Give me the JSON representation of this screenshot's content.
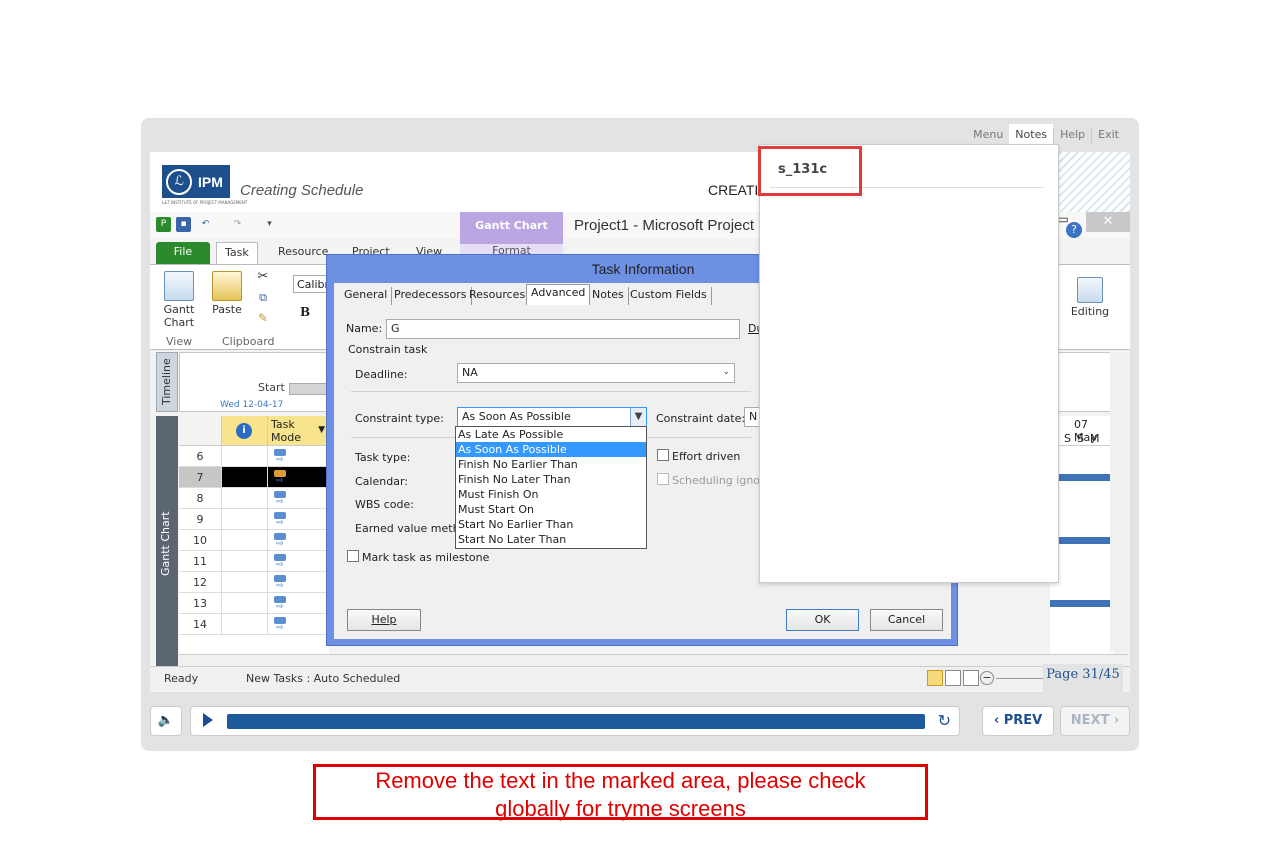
{
  "player": {
    "topnav": [
      "Menu",
      "Notes",
      "Help",
      "Exit"
    ],
    "active_nav": "Notes",
    "course_title": "Creating Schedule",
    "header_right": "CREATI",
    "page_counter": "Page 31/45",
    "prev_label": "PREV",
    "next_label": "NEXT"
  },
  "logo": {
    "text": "IPM",
    "sub": "L&T INSTITUTE OF PROJECT MANAGEMENT"
  },
  "msp": {
    "app_title": "Project1  -  Microsoft Project",
    "contextual_tab": "Gantt Chart Tools",
    "format_tab": "Format",
    "tabs": [
      "File",
      "Task",
      "Resource",
      "Project",
      "View"
    ],
    "ribbon": {
      "gantt_label": "Gantt",
      "chart_label": "Chart",
      "view_group": "View",
      "paste_label": "Paste",
      "clipboard_group": "Clipboard",
      "font_name": "Calibr",
      "bold": "B",
      "editing_label": "Editing"
    },
    "timeline": {
      "label": "Timeline",
      "start": "Start",
      "date": "Wed 12-04-17"
    },
    "gantt": {
      "label": "Gantt Chart",
      "col_info": "i",
      "col_mode": "Task Mode",
      "rows": [
        "6",
        "7",
        "8",
        "9",
        "10",
        "11",
        "12",
        "13",
        "14"
      ],
      "selected_row": "7",
      "timescale_top": "07 May",
      "timescale_days": [
        "S",
        "S",
        "M"
      ]
    },
    "status": {
      "ready": "Ready",
      "new_tasks": "New Tasks : Auto Scheduled"
    }
  },
  "dialog": {
    "title": "Task Information",
    "tabs": [
      "General",
      "Predecessors",
      "Resources",
      "Advanced",
      "Notes",
      "Custom Fields"
    ],
    "active_tab": "Advanced",
    "name_label": "Name:",
    "name_value": "G",
    "duration_label": "Du",
    "constrain_group": "Constrain task",
    "deadline_label": "Deadline:",
    "deadline_value": "NA",
    "constraint_type_label": "Constraint type:",
    "constraint_type_value": "As Soon As Possible",
    "constraint_date_label": "Constraint date:",
    "constraint_date_value": "N",
    "task_type_label": "Task type:",
    "calendar_label": "Calendar:",
    "wbs_label": "WBS code:",
    "evm_label": "Earned value method",
    "effort_driven": "Effort driven",
    "scheduling_ignores": "Scheduling ignores",
    "milestone": "Mark task as milestone",
    "help": "Help",
    "ok": "OK",
    "cancel": "Cancel",
    "constraint_options": [
      "As Late As Possible",
      "As Soon As Possible",
      "Finish No Earlier Than",
      "Finish No Later Than",
      "Must Finish On",
      "Must Start On",
      "Start No Earlier Than",
      "Start No Later Than"
    ],
    "selected_option": "As Soon As Possible"
  },
  "notes": {
    "slide_id": "s_131c"
  },
  "instruction": {
    "line1": "Remove the text in the marked area, please check",
    "line2": "globally for tryme screens"
  },
  "colors": {
    "accent": "#1f5a9c",
    "highlight_red": "#e00000",
    "dialog_frame": "#6d8fe4"
  }
}
